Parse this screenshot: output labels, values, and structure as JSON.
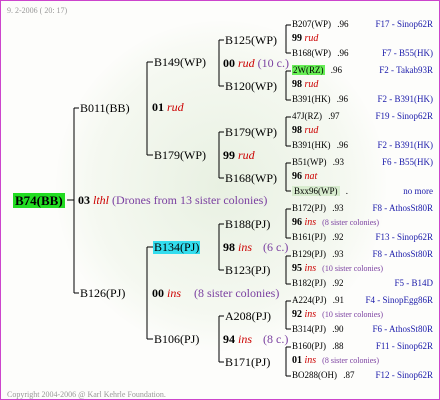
{
  "date": "9.  2-2006 ( 20: 17)",
  "copyright": "Copyright 2004-2006 @ Karl Kehrle Foundation.",
  "root": {
    "id": "B74(BB)"
  },
  "gen1": {
    "year": "03",
    "race": "lthl",
    "note": "(Drones from 13 sister colonies)",
    "father": "B011(BB)",
    "mother": "B126(PJ)"
  },
  "gen2": {
    "father_side": {
      "year": "01",
      "race": "rud",
      "father": "B149(WP)",
      "mother": "B179(WP)"
    },
    "mother_side": {
      "year": "00",
      "race": "ins",
      "note": "(8 sister colonies)",
      "father": "B134(PJ)",
      "mother": "B106(PJ)"
    }
  },
  "gen3": {
    "b149": {
      "year": "00",
      "race": "rud",
      "note": "(10 c.)",
      "father": "B125(WP)",
      "mother": "B120(WP)"
    },
    "b179": {
      "year": "99",
      "race": "rud",
      "father": "B179(WP)",
      "mother": "B168(WP)"
    },
    "b134": {
      "year": "98",
      "race": "ins",
      "note": "(6 c.)",
      "father": "B188(PJ)",
      "mother": "B123(PJ)"
    },
    "b106": {
      "year": "94",
      "race": "ins",
      "note": "(8 c.)",
      "father": "A208(PJ)",
      "mother": "B171(PJ)"
    }
  },
  "gen4": [
    {
      "year": "99",
      "race": "rud",
      "note": "",
      "father": {
        "id": "B207(WP)",
        "score": ".96",
        "ref": "F17 - Sinop62R"
      },
      "mother": {
        "id": "B168(WP)",
        "score": ".96",
        "ref": "F7 - B55(HK)"
      }
    },
    {
      "year": "98",
      "race": "rud",
      "note": "",
      "father": {
        "id": "2W(RZ)",
        "score": ".96",
        "ref": "F2 - Takab93R"
      },
      "mother": {
        "id": "B391(HK)",
        "score": ".96",
        "ref": "F2 - B391(HK)"
      }
    },
    {
      "year": "98",
      "race": "rud",
      "note": "",
      "father": {
        "id": "47J(RZ)",
        "score": ".97",
        "ref": "F19 - Sinop62R"
      },
      "mother": {
        "id": "B391(HK)",
        "score": ".96",
        "ref": "F2 - B391(HK)"
      }
    },
    {
      "year": "96",
      "race": "nat",
      "note": "",
      "father": {
        "id": "B51(WP)",
        "score": ".93",
        "ref": "F6 - B55(HK)"
      },
      "mother": {
        "id": "Bxx96(WP)",
        "score": ".",
        "ref": "no more"
      }
    },
    {
      "year": "96",
      "race": "ins",
      "note": "(8 sister colonies)",
      "father": {
        "id": "B172(PJ)",
        "score": ".93",
        "ref": "F8 - AthosSt80R"
      },
      "mother": {
        "id": "B161(PJ)",
        "score": ".92",
        "ref": "F13 - Sinop62R"
      }
    },
    {
      "year": "95",
      "race": "ins",
      "note": "(10 sister colonies)",
      "father": {
        "id": "B129(PJ)",
        "score": ".93",
        "ref": "F8 - AthosSt80R"
      },
      "mother": {
        "id": "B182(PJ)",
        "score": ".92",
        "ref": "F5 - B14D"
      }
    },
    {
      "year": "92",
      "race": "ins",
      "note": "(10 sister colonies)",
      "father": {
        "id": "A224(PJ)",
        "score": ".91",
        "ref": "F4 - SinopEgg86R"
      },
      "mother": {
        "id": "B314(PJ)",
        "score": ".90",
        "ref": "F6 - AthosSt80R"
      }
    },
    {
      "year": "01",
      "race": "ins",
      "note": "(8 sister colonies)",
      "father": {
        "id": "B160(PJ)",
        "score": ".88",
        "ref": "F11 - Sinop62R"
      },
      "mother": {
        "id": "BO288(OH)",
        "score": ".87",
        "ref": "F12 - Sinop62R"
      }
    }
  ]
}
